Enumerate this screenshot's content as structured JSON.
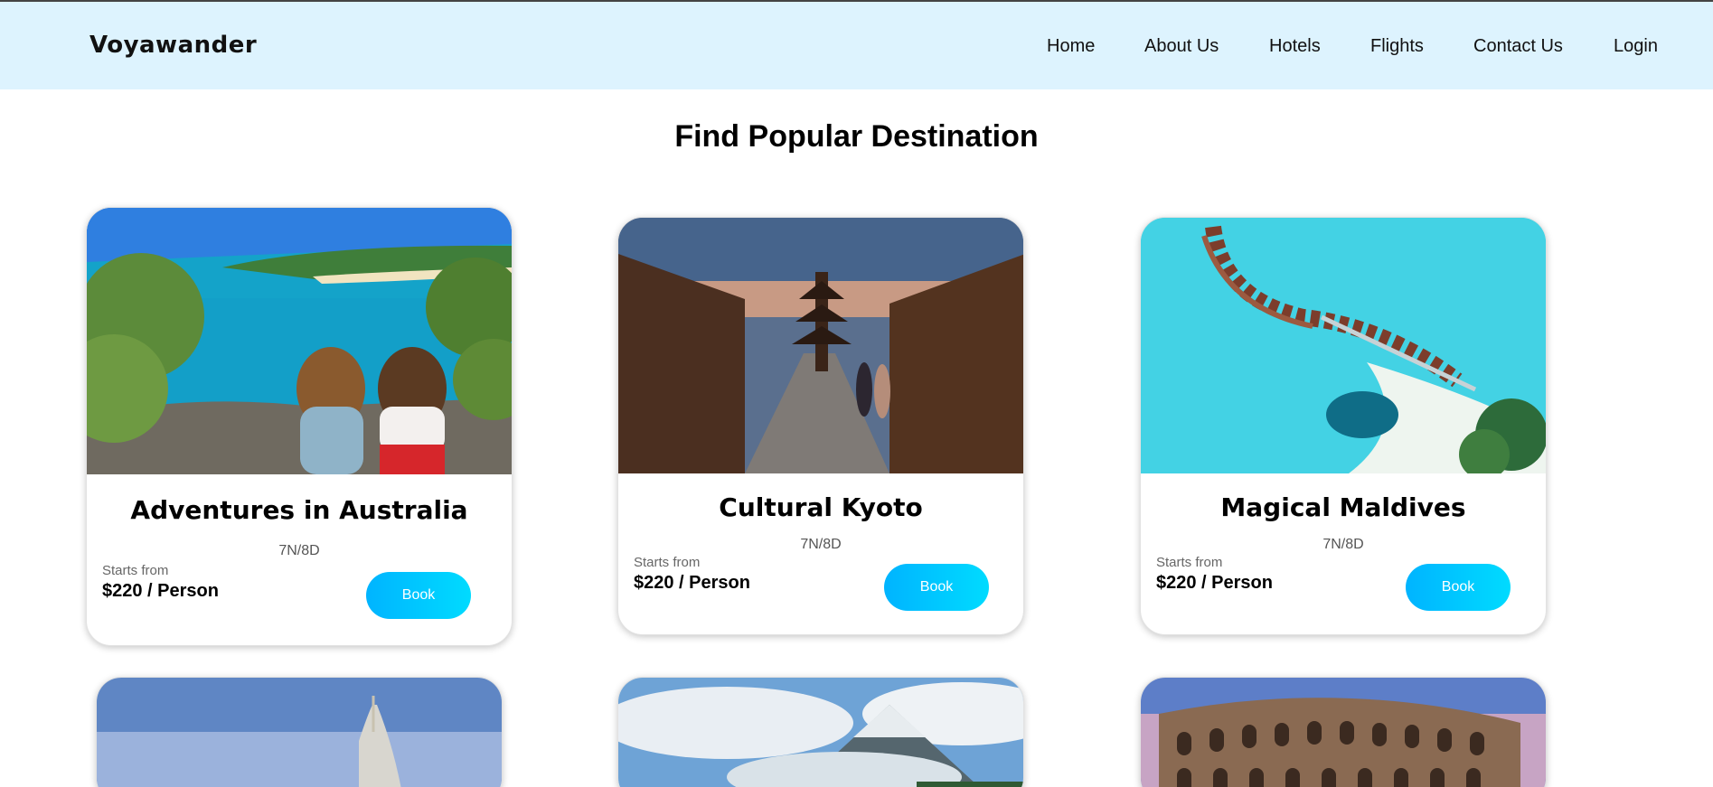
{
  "navbar": {
    "brand": "Voyawander",
    "links": [
      "Home",
      "About Us",
      "Hotels",
      "Flights",
      "Contact Us",
      "Login"
    ]
  },
  "main": {
    "title": "Find Popular Destination",
    "cards": [
      {
        "title": "Adventures in Australia",
        "duration": "7N/8D",
        "starts_label": "Starts from",
        "price": "$220 / Person",
        "button": "Book"
      },
      {
        "title": "Cultural Kyoto",
        "duration": "7N/8D",
        "starts_label": "Starts from",
        "price": "$220 / Person",
        "button": "Book"
      },
      {
        "title": "Magical Maldives",
        "duration": "7N/8D",
        "starts_label": "Starts from",
        "price": "$220 / Person",
        "button": "Book"
      }
    ]
  },
  "colors": {
    "navbar_bg": "#ddf3fe",
    "button_gradient_start": "#00b4ff",
    "button_gradient_end": "#00dbff"
  }
}
